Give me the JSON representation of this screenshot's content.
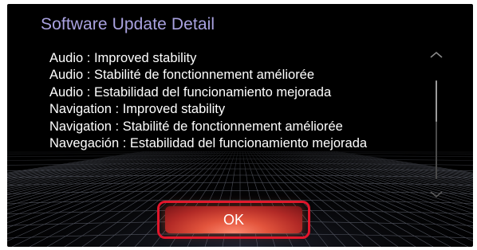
{
  "dialog": {
    "title": "Software Update Detail",
    "lines": [
      "Audio : Improved stability",
      "Audio : Stabilité de fonctionnement améliorée",
      "Audio : Estabilidad del funcionamiento mejorada",
      "Navigation : Improved stability",
      "Navigation : Stabilité de fonctionnement améliorée",
      "Navegación : Estabilidad del funcionamiento mejorada"
    ],
    "ok_label": "OK",
    "scroll_position": 0.0
  },
  "colors": {
    "background": "#000000",
    "title": "#a9a2e0",
    "text": "#ffffff",
    "focus_frame": "#e0142c",
    "button": "#c8382c"
  },
  "icons": {
    "scroll_up": "chevron-up-icon",
    "scroll_down": "chevron-down-icon"
  }
}
